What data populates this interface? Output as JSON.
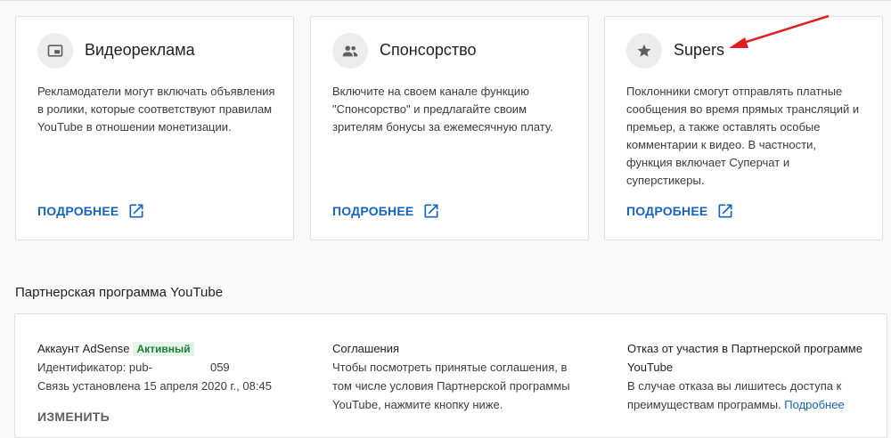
{
  "cards": [
    {
      "title": "Видеореклама",
      "icon": "picture-in-picture-icon",
      "description": "Рекламодатели могут включать объявления в ролики, которые соответствуют правилам YouTube в отношении монетизации.",
      "link_label": "ПОДРОБНЕЕ"
    },
    {
      "title": "Спонсорство",
      "icon": "people-icon",
      "description": "Включите на своем канале функцию \"Спонсорство\" и предлагайте своим зрителям бонусы за ежемесячную плату.",
      "link_label": "ПОДРОБНЕЕ"
    },
    {
      "title": "Supers",
      "icon": "star-icon",
      "description": "Поклонники смогут отправлять платные сообщения во время прямых трансляций и премьер, а также оставлять особые комментарии к видео. В частности, функция включает Суперчат и суперстикеры.",
      "link_label": "ПОДРОБНЕЕ"
    }
  ],
  "ypp": {
    "section_title": "Партнерская программа YouTube",
    "adsense": {
      "label": "Аккаунт AdSense",
      "status": "Активный",
      "id_label": "Идентификатор: pub-",
      "id_masked": "                  ",
      "id_suffix": "059",
      "connected": "Связь установлена 15 апреля 2020 г., 08:45",
      "change_label": "ИЗМЕНИТЬ"
    },
    "agreements": {
      "title": "Соглашения",
      "text": "Чтобы посмотреть принятые соглашения, в том числе условия Партнерской программы YouTube, нажмите кнопку ниже."
    },
    "optout": {
      "title": "Отказ от участия в Партнерской программе YouTube",
      "text": "В случае отказа вы лишитесь доступа к преимуществам программы.",
      "link": "Подробнее"
    }
  },
  "colors": {
    "link": "#1565c0",
    "active_badge_bg": "#e6f4ea",
    "active_badge_text": "#188038",
    "annotation_arrow": "#e02020"
  }
}
